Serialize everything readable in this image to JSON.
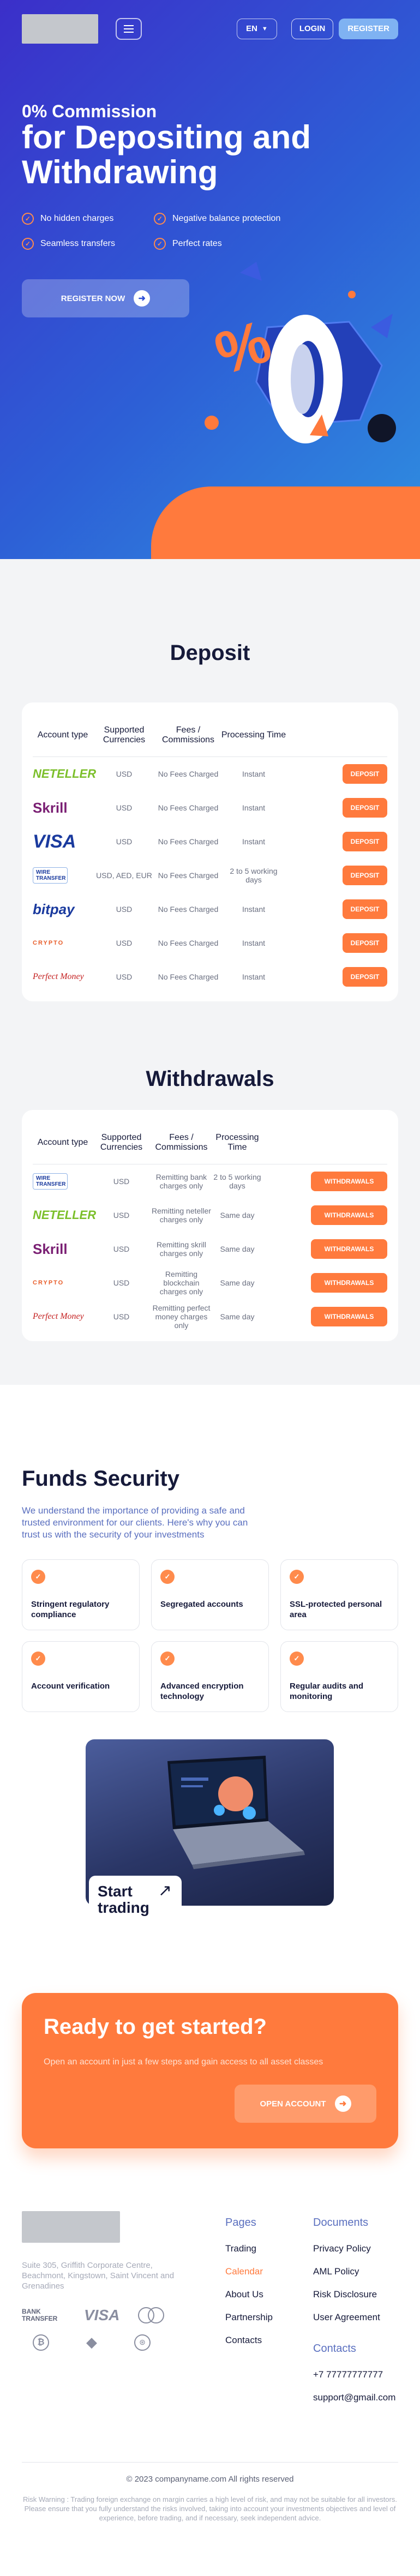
{
  "header": {
    "language": "EN",
    "login": "LOGIN",
    "register": "REGISTER"
  },
  "hero": {
    "subtitle": "0% Commission",
    "title": "for Depositing and Withdrawing",
    "features": [
      "No hidden charges",
      "Negative balance protection",
      "Seamless transfers",
      "Perfect rates"
    ],
    "cta": "REGISTER NOW"
  },
  "deposit": {
    "title": "Deposit",
    "headers": [
      "Account type",
      "Supported Currencies",
      "Fees / Commissions",
      "Processing Time"
    ],
    "button": "DEPOSIT",
    "rows": [
      {
        "logo": "NETELLER",
        "currency": "USD",
        "fee": "No Fees Charged",
        "time": "Instant"
      },
      {
        "logo": "Skrill",
        "currency": "USD",
        "fee": "No Fees Charged",
        "time": "Instant"
      },
      {
        "logo": "VISA",
        "currency": "USD",
        "fee": "No Fees Charged",
        "time": "Instant"
      },
      {
        "logo": "WIRE TRANSFER",
        "currency": "USD, AED, EUR",
        "fee": "No Fees Charged",
        "time": "2 to 5 working days"
      },
      {
        "logo": "bitpay",
        "currency": "USD",
        "fee": "No Fees Charged",
        "time": "Instant"
      },
      {
        "logo": "CRYPTO",
        "currency": "USD",
        "fee": "No Fees Charged",
        "time": "Instant"
      },
      {
        "logo": "Perfect Money",
        "currency": "USD",
        "fee": "No Fees Charged",
        "time": "Instant"
      }
    ]
  },
  "withdrawals": {
    "title": "Withdrawals",
    "headers": [
      "Account type",
      "Supported Currencies",
      "Fees / Commissions",
      "Processing Time"
    ],
    "button": "WITHDRAWALS",
    "rows": [
      {
        "logo": "WIRE TRANSFER",
        "currency": "USD",
        "fee": "Remitting bank charges only",
        "time": "2 to 5 working days"
      },
      {
        "logo": "NETELLER",
        "currency": "USD",
        "fee": "Remitting neteller charges only",
        "time": "Same day"
      },
      {
        "logo": "Skrill",
        "currency": "USD",
        "fee": "Remitting skrill charges only",
        "time": "Same day"
      },
      {
        "logo": "CRYPTO",
        "currency": "USD",
        "fee": "Remitting blockchain charges only",
        "time": "Same day"
      },
      {
        "logo": "Perfect Money",
        "currency": "USD",
        "fee": "Remitting perfect money charges only",
        "time": "Same day"
      }
    ]
  },
  "security": {
    "title": "Funds Security",
    "text": "We understand the importance of providing a safe and trusted environment for our clients. Here's why you can trust us with the security of your investments",
    "items": [
      "Stringent regulatory compliance",
      "Segregated accounts",
      "SSL-protected personal area",
      "Account verification",
      "Advanced encryption technology",
      "Regular audits and monitoring"
    ],
    "start": "Start trading"
  },
  "ready": {
    "title": "Ready to get started?",
    "text": "Open an account in just a few steps and gain access to all asset classes",
    "cta": "OPEN ACCOUNT"
  },
  "footer": {
    "address": "Suite 305, Griffith Corporate Centre, Beachmont, Kingstown, Saint Vincent and Grenadines",
    "pages_title": "Pages",
    "pages": [
      "Trading",
      "Calendar",
      "About Us",
      "Partnership",
      "Contacts"
    ],
    "docs_title": "Documents",
    "docs": [
      "Privacy Policy",
      "AML Policy",
      "Risk Disclosure",
      "User Agreement"
    ],
    "contacts_title": "Contacts",
    "phone": "+7 77777777777",
    "email": "support@gmail.com",
    "copyright": "© 2023 companyname.com All rights reserved",
    "risk": "Risk Warning : Trading foreign exchange on margin carries a high level of risk, and may not be suitable for all investors. Please ensure that you fully understand the risks involved, taking into account your investments objectives and level of experience, before trading, and if necessary, seek independent advice.",
    "pay": [
      "BANK TRANSFER",
      "VISA",
      "MasterCard"
    ]
  },
  "colors": {
    "accent": "#ff7a3d",
    "blue": "#2d4ed6"
  }
}
